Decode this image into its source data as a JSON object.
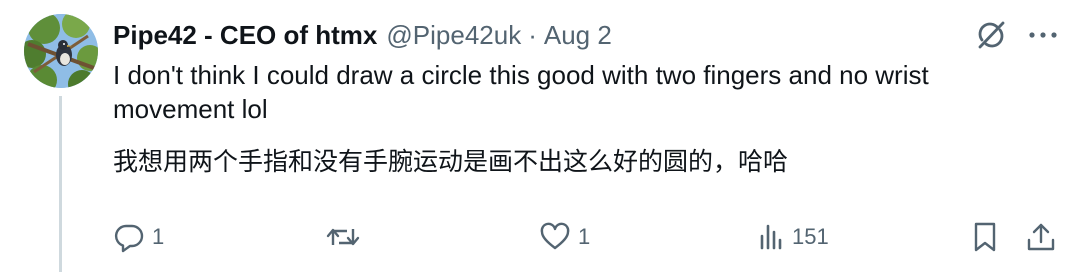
{
  "tweet": {
    "author": {
      "display_name": "Pipe42 - CEO of htmx",
      "handle": "@Pipe42uk"
    },
    "separator": "·",
    "date": "Aug 2",
    "text": "I don't think I could draw a circle this good with two fingers and no wrist movement lol",
    "translation": "我想用两个手指和没有手腕运动是画不出这么好的圆的，哈哈"
  },
  "actions": {
    "reply": {
      "icon": "reply-icon",
      "count": "1"
    },
    "repost": {
      "icon": "repost-icon",
      "count": ""
    },
    "like": {
      "icon": "heart-icon",
      "count": "1"
    },
    "views": {
      "icon": "views-icon",
      "count": "151"
    },
    "bookmark": {
      "icon": "bookmark-icon"
    },
    "share": {
      "icon": "share-icon"
    }
  },
  "colors": {
    "text_primary": "#0f1419",
    "text_secondary": "#536471",
    "thread_line": "#cfd9de"
  }
}
